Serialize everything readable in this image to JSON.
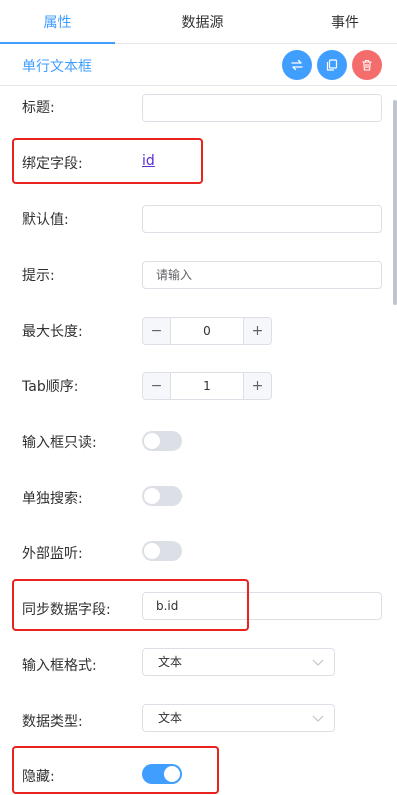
{
  "tabs": [
    {
      "label": "属性",
      "active": true
    },
    {
      "label": "数据源",
      "active": false
    },
    {
      "label": "事件",
      "active": false
    }
  ],
  "widget": {
    "title": "单行文本框"
  },
  "actions": {
    "swap_icon": "swap-icon",
    "copy_icon": "copy-icon",
    "delete_icon": "trash-icon"
  },
  "fields": {
    "title": {
      "label": "标题:",
      "value": ""
    },
    "bind": {
      "label": "绑定字段:",
      "value": "id"
    },
    "default": {
      "label": "默认值:",
      "value": ""
    },
    "hint": {
      "label": "提示:",
      "value": "请输入"
    },
    "maxlen": {
      "label": "最大长度:",
      "value": "0",
      "minus": "−",
      "plus": "+"
    },
    "taborder": {
      "label": "Tab顺序:",
      "value": "1",
      "minus": "−",
      "plus": "+"
    },
    "readonly": {
      "label": "输入框只读:",
      "on": false
    },
    "search": {
      "label": "单独搜索:",
      "on": false
    },
    "listen": {
      "label": "外部监听:",
      "on": false
    },
    "sync": {
      "label": "同步数据字段:",
      "value": "b.id"
    },
    "format": {
      "label": "输入框格式:",
      "value": "文本"
    },
    "datatype": {
      "label": "数据类型:",
      "value": "文本"
    },
    "hidden": {
      "label": "隐藏:",
      "on": true
    }
  },
  "colors": {
    "accent": "#409eff",
    "danger": "#f56c6c",
    "highlight": "#e8221c",
    "link": "#5b2bd6"
  }
}
